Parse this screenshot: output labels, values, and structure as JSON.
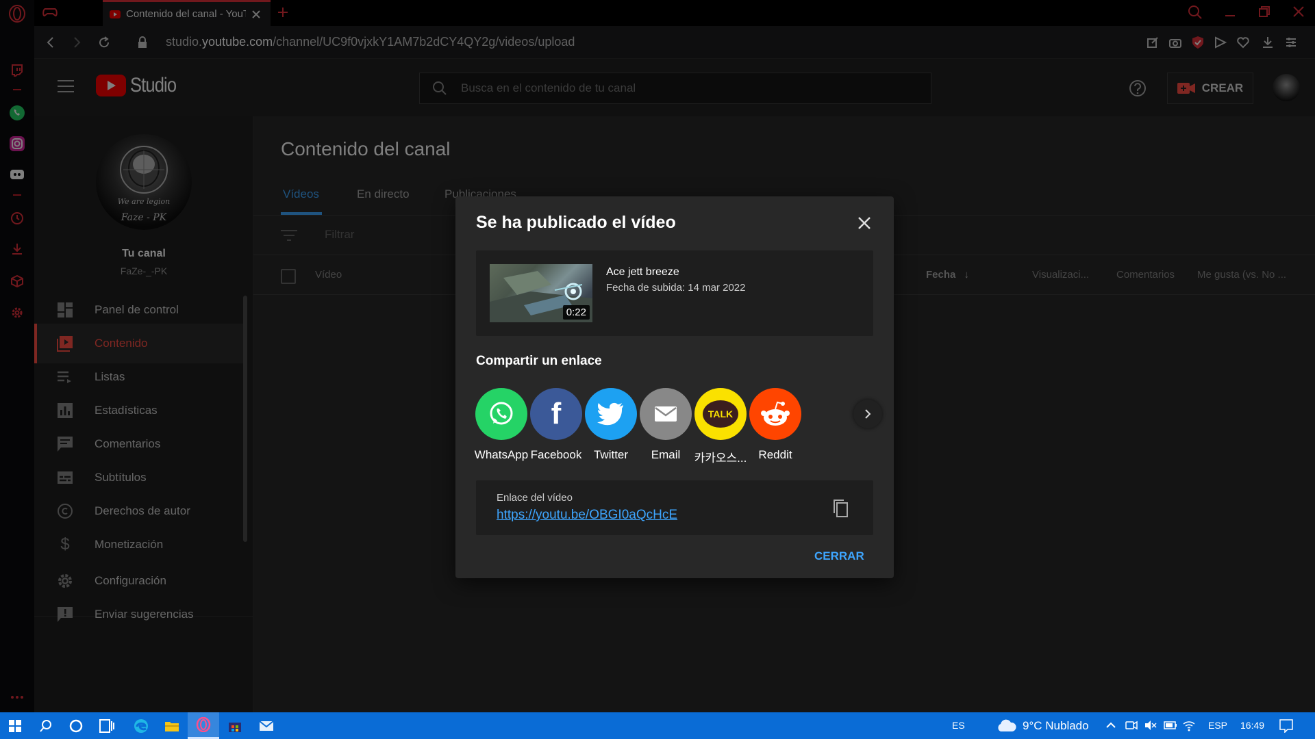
{
  "browser": {
    "tab_title": "Contenido del canal - YouT",
    "url_prefix": "studio.",
    "url_host": "youtube.com",
    "url_path": "/channel/UC9f0vjxkY1AM7b2dCY4QY2g/videos/upload"
  },
  "studio": {
    "logo_text": "Studio",
    "search_placeholder": "Busca en el contenido de tu canal",
    "crear_label": "CREAR"
  },
  "sidebar": {
    "channel_heading": "Tu canal",
    "channel_name": "FaZe-_-PK",
    "avatar_text": [
      "We are legion",
      "Faze - PK"
    ],
    "items": [
      {
        "label": "Panel de control",
        "icon": "dashboard-icon"
      },
      {
        "label": "Contenido",
        "icon": "content-icon",
        "active": true
      },
      {
        "label": "Listas",
        "icon": "playlist-icon"
      },
      {
        "label": "Estadísticas",
        "icon": "analytics-icon"
      },
      {
        "label": "Comentarios",
        "icon": "comments-icon"
      },
      {
        "label": "Subtítulos",
        "icon": "subtitles-icon"
      },
      {
        "label": "Derechos de autor",
        "icon": "copyright-icon"
      },
      {
        "label": "Monetización",
        "icon": "dollar-icon"
      },
      {
        "label": "Configuración",
        "icon": "gear-icon"
      },
      {
        "label": "Enviar sugerencias",
        "icon": "feedback-icon"
      }
    ]
  },
  "main": {
    "title": "Contenido del canal",
    "tabs": [
      "Vídeos",
      "En directo",
      "Publicaciones"
    ],
    "filter_placeholder": "Filtrar",
    "columns": {
      "video": "Vídeo",
      "date": "Fecha",
      "views": "Visualizaci...",
      "comments": "Comentarios",
      "likes": "Me gusta (vs. No ..."
    }
  },
  "dialog": {
    "title": "Se ha publicado el vídeo",
    "video_title": "Ace jett breeze",
    "upload_date": "Fecha de subida: 14 mar 2022",
    "duration": "0:22",
    "share_heading": "Compartir un enlace",
    "share_targets": [
      {
        "label": "WhatsApp",
        "color": "#25d366",
        "icon": "whatsapp-icon"
      },
      {
        "label": "Facebook",
        "color": "#3b5998",
        "icon": "facebook-icon"
      },
      {
        "label": "Twitter",
        "color": "#1da1f2",
        "icon": "twitter-icon"
      },
      {
        "label": "Email",
        "color": "#888888",
        "icon": "email-icon"
      },
      {
        "label": "카카오스...",
        "color": "#fae100",
        "icon": "kakaotalk-icon",
        "icon_text": "TALK"
      },
      {
        "label": "Reddit",
        "color": "#ff4500",
        "icon": "reddit-icon"
      }
    ],
    "link_label": "Enlace del vídeo",
    "link_url": "https://youtu.be/OBGI0aQcHcE",
    "close_label": "CERRAR"
  },
  "taskbar": {
    "language": "ES",
    "weather": "9°C  Nublado",
    "keyboard": "ESP",
    "time": "16:49"
  },
  "colors": {
    "youtube_red": "#ff0000",
    "accent_blue": "#3ea6ff",
    "opera_red": "#e3303a",
    "taskbar_blue": "#0a6cd6"
  }
}
